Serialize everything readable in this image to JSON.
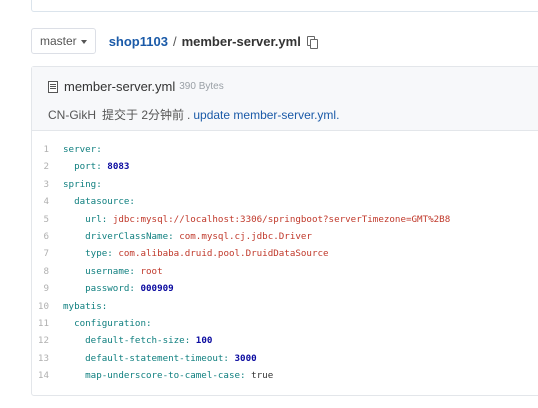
{
  "toolbar": {
    "branch": "master",
    "repo": "shop1103",
    "separator": "/",
    "file": "member-server.yml"
  },
  "file_header": {
    "name": "member-server.yml",
    "size": "390 Bytes",
    "author": "CN-GikH",
    "time": "提交于 2分钟前",
    "dot": ".",
    "message": "update member-server.yml."
  },
  "code": [
    {
      "num": "1",
      "indent": "",
      "key": "server:",
      "value": "",
      "vtype": ""
    },
    {
      "num": "2",
      "indent": "  ",
      "key": "port:",
      "value": "8083",
      "vtype": "n"
    },
    {
      "num": "3",
      "indent": "",
      "key": "spring:",
      "value": "",
      "vtype": ""
    },
    {
      "num": "4",
      "indent": "  ",
      "key": "datasource:",
      "value": "",
      "vtype": ""
    },
    {
      "num": "5",
      "indent": "    ",
      "key": "url:",
      "value": "jdbc:mysql://localhost:3306/springboot?serverTimezone=GMT%2B8",
      "vtype": "s"
    },
    {
      "num": "6",
      "indent": "    ",
      "key": "driverClassName:",
      "value": "com.mysql.cj.jdbc.Driver",
      "vtype": "s"
    },
    {
      "num": "7",
      "indent": "    ",
      "key": "type:",
      "value": "com.alibaba.druid.pool.DruidDataSource",
      "vtype": "s"
    },
    {
      "num": "8",
      "indent": "    ",
      "key": "username:",
      "value": "root",
      "vtype": "s"
    },
    {
      "num": "9",
      "indent": "    ",
      "key": "password:",
      "value": "000909",
      "vtype": "n"
    },
    {
      "num": "10",
      "indent": "",
      "key": "mybatis:",
      "value": "",
      "vtype": ""
    },
    {
      "num": "11",
      "indent": "  ",
      "key": "configuration:",
      "value": "",
      "vtype": ""
    },
    {
      "num": "12",
      "indent": "    ",
      "key": "default-fetch-size:",
      "value": "100",
      "vtype": "n"
    },
    {
      "num": "13",
      "indent": "    ",
      "key": "default-statement-timeout:",
      "value": "3000",
      "vtype": "n"
    },
    {
      "num": "14",
      "indent": "    ",
      "key": "map-underscore-to-camel-case:",
      "value": "true",
      "vtype": "t"
    }
  ]
}
